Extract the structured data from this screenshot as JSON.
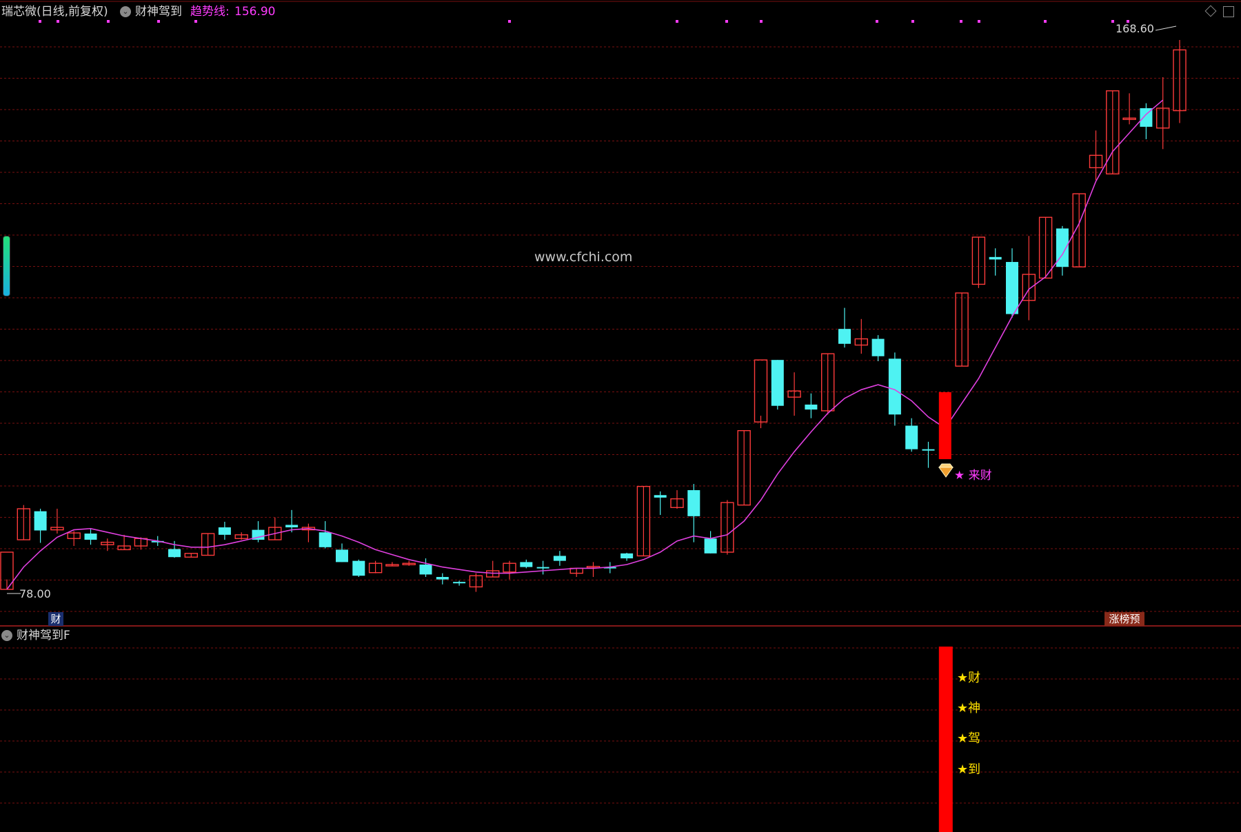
{
  "header": {
    "title": "瑞芯微(日线,前复权)",
    "indicator_name": "财神驾到",
    "trend_label": "趋势线:",
    "trend_value": "156.90"
  },
  "watermark": "www.cfchi.com",
  "price_labels": {
    "high": "168.60",
    "low": "78.00"
  },
  "signal": {
    "label": "★ 来财"
  },
  "badges": {
    "left": "财",
    "right": "涨榜预"
  },
  "sub_panel": {
    "title": "财神驾到F",
    "labels": [
      "★财",
      "★神",
      "★驾",
      "★到"
    ]
  },
  "colors": {
    "up": "#ff3b3b",
    "down": "#4ef2f2",
    "trend": "#e040e0",
    "grid": "#7a1010",
    "signal_bar": "#ff0000",
    "background": "#000000"
  },
  "chart_data": {
    "type": "candlestick",
    "series_name": "趋势线",
    "price_range": [
      78.0,
      168.6
    ],
    "candles": [
      {
        "o": 78,
        "h": 79.6,
        "l": 78,
        "c": 84,
        "up": true
      },
      {
        "o": 86,
        "h": 91.6,
        "l": 86,
        "c": 91,
        "up": true
      },
      {
        "o": 90.6,
        "h": 91,
        "l": 85.5,
        "c": 87.5,
        "up": false
      },
      {
        "o": 88,
        "h": 91,
        "l": 87,
        "c": 87.6,
        "up": true
      },
      {
        "o": 86.2,
        "h": 87.4,
        "l": 85,
        "c": 87.1,
        "up": true
      },
      {
        "o": 87,
        "h": 87.8,
        "l": 85.2,
        "c": 86,
        "up": false
      },
      {
        "o": 85.2,
        "h": 86.2,
        "l": 84.2,
        "c": 85.6,
        "up": true
      },
      {
        "o": 84.4,
        "h": 86.8,
        "l": 84.4,
        "c": 85,
        "up": true
      },
      {
        "o": 85,
        "h": 86.4,
        "l": 84.4,
        "c": 86.2,
        "up": true
      },
      {
        "o": 85.6,
        "h": 86.6,
        "l": 85,
        "c": 85.8,
        "up": false
      },
      {
        "o": 84.5,
        "h": 85.8,
        "l": 83.1,
        "c": 83.2,
        "up": false
      },
      {
        "o": 83.2,
        "h": 83.8,
        "l": 83.2,
        "c": 83.8,
        "up": true
      },
      {
        "o": 83.5,
        "h": 87,
        "l": 83.5,
        "c": 87,
        "up": true
      },
      {
        "o": 88,
        "h": 88.9,
        "l": 86,
        "c": 86.8,
        "up": false
      },
      {
        "o": 86.2,
        "h": 87.2,
        "l": 86,
        "c": 86.8,
        "up": true
      },
      {
        "o": 87.6,
        "h": 89,
        "l": 85.6,
        "c": 86,
        "up": false
      },
      {
        "o": 86,
        "h": 89.6,
        "l": 86,
        "c": 88,
        "up": true
      },
      {
        "o": 88.4,
        "h": 90.8,
        "l": 87.2,
        "c": 88,
        "up": false
      },
      {
        "o": 87.6,
        "h": 88.6,
        "l": 85.6,
        "c": 88,
        "up": true
      },
      {
        "o": 87.2,
        "h": 89,
        "l": 84.6,
        "c": 84.8,
        "up": false
      },
      {
        "o": 84.4,
        "h": 85.4,
        "l": 82.4,
        "c": 82.4,
        "up": false
      },
      {
        "o": 82.6,
        "h": 82.8,
        "l": 80,
        "c": 80.2,
        "up": false
      },
      {
        "o": 80.7,
        "h": 82.6,
        "l": 80.6,
        "c": 82.2,
        "up": true
      },
      {
        "o": 82,
        "h": 82.4,
        "l": 81.8,
        "c": 82,
        "up": true
      },
      {
        "o": 82.2,
        "h": 82.6,
        "l": 81.8,
        "c": 82,
        "up": true
      },
      {
        "o": 82,
        "h": 83,
        "l": 80,
        "c": 80.4,
        "up": false
      },
      {
        "o": 80,
        "h": 80.6,
        "l": 78.8,
        "c": 79.6,
        "up": false
      },
      {
        "o": 79.2,
        "h": 79.4,
        "l": 78.6,
        "c": 79,
        "up": false
      },
      {
        "o": 78.4,
        "h": 80.6,
        "l": 77.6,
        "c": 80.2,
        "up": true
      },
      {
        "o": 80,
        "h": 82.6,
        "l": 80,
        "c": 81,
        "up": true
      },
      {
        "o": 80.8,
        "h": 82.6,
        "l": 79.6,
        "c": 82.2,
        "up": true
      },
      {
        "o": 82.4,
        "h": 82.8,
        "l": 81.4,
        "c": 81.6,
        "up": false
      },
      {
        "o": 81.6,
        "h": 82.6,
        "l": 80.4,
        "c": 81.4,
        "up": false
      },
      {
        "o": 82.6,
        "h": 84.2,
        "l": 81.8,
        "c": 83.4,
        "up": false
      },
      {
        "o": 80.6,
        "h": 81.4,
        "l": 80,
        "c": 81.4,
        "up": true
      },
      {
        "o": 81.6,
        "h": 82.4,
        "l": 80,
        "c": 81.7,
        "up": true
      },
      {
        "o": 81.6,
        "h": 82.4,
        "l": 80.6,
        "c": 81.4,
        "up": false
      },
      {
        "o": 83.8,
        "h": 83.9,
        "l": 82.6,
        "c": 83,
        "up": false
      },
      {
        "o": 83.4,
        "h": 94.6,
        "l": 83.4,
        "c": 94.6,
        "up": true
      },
      {
        "o": 93.2,
        "h": 93.8,
        "l": 90,
        "c": 92.8,
        "up": false
      },
      {
        "o": 91.2,
        "h": 94,
        "l": 91,
        "c": 92.6,
        "up": true
      },
      {
        "o": 94,
        "h": 95,
        "l": 85.6,
        "c": 89.8,
        "up": false
      },
      {
        "o": 86.2,
        "h": 87.4,
        "l": 83.8,
        "c": 83.8,
        "up": false
      },
      {
        "o": 84,
        "h": 92.4,
        "l": 83.6,
        "c": 92,
        "up": true
      },
      {
        "o": 91.6,
        "h": 103.6,
        "l": 91.6,
        "c": 103.6,
        "up": true
      },
      {
        "o": 105,
        "h": 106,
        "l": 104,
        "c": 115,
        "up": true
      },
      {
        "o": 115,
        "h": 115,
        "l": 107,
        "c": 107.6,
        "up": false
      },
      {
        "o": 109,
        "h": 113,
        "l": 106,
        "c": 110,
        "up": true
      },
      {
        "o": 107.8,
        "h": 109.6,
        "l": 105.6,
        "c": 107,
        "up": false
      },
      {
        "o": 106.8,
        "h": 116,
        "l": 106.2,
        "c": 116,
        "up": true
      },
      {
        "o": 120,
        "h": 123.4,
        "l": 117,
        "c": 117.6,
        "up": false
      },
      {
        "o": 117.4,
        "h": 121.6,
        "l": 116,
        "c": 118.4,
        "up": true
      },
      {
        "o": 118.4,
        "h": 119,
        "l": 114.8,
        "c": 115.6,
        "up": false
      },
      {
        "o": 115.2,
        "h": 116.2,
        "l": 104.4,
        "c": 106.2,
        "up": false
      },
      {
        "o": 104.4,
        "h": 105.6,
        "l": 100.2,
        "c": 100.6,
        "up": false
      },
      {
        "o": 100.6,
        "h": 101.8,
        "l": 97.6,
        "c": 100.6,
        "up": false
      },
      {
        "o": 99,
        "h": 109.8,
        "l": 99,
        "c": 109.8,
        "up": true
      },
      {
        "o": 114,
        "h": 125.8,
        "l": 114,
        "c": 125.8,
        "up": true
      },
      {
        "o": 127.2,
        "h": 134.8,
        "l": 126.6,
        "c": 134.8,
        "up": true
      },
      {
        "o": 131.6,
        "h": 133,
        "l": 128.6,
        "c": 131.2,
        "up": false
      },
      {
        "o": 130.8,
        "h": 133,
        "l": 121.8,
        "c": 122.4,
        "up": false
      },
      {
        "o": 124.6,
        "h": 135,
        "l": 121.4,
        "c": 128.8,
        "up": true
      },
      {
        "o": 128.2,
        "h": 138,
        "l": 128.2,
        "c": 138,
        "up": true
      },
      {
        "o": 136.2,
        "h": 136.6,
        "l": 128.6,
        "c": 130,
        "up": false
      },
      {
        "o": 130,
        "h": 141.8,
        "l": 130,
        "c": 141.8,
        "up": true
      },
      {
        "o": 146,
        "h": 152,
        "l": 144,
        "c": 148,
        "up": true
      },
      {
        "o": 145,
        "h": 158.4,
        "l": 145,
        "c": 158.4,
        "up": true
      },
      {
        "o": 154,
        "h": 158,
        "l": 153,
        "c": 154,
        "up": true
      },
      {
        "o": 155.6,
        "h": 156.4,
        "l": 150.6,
        "c": 152.6,
        "up": false
      },
      {
        "o": 155.6,
        "h": 160.6,
        "l": 149,
        "c": 152.4,
        "up": true
      },
      {
        "o": 155.2,
        "h": 166.6,
        "l": 153.2,
        "c": 165,
        "up": true
      }
    ],
    "trend_line": [
      78,
      81.6,
      84.2,
      86.4,
      87.6,
      87.8,
      87.2,
      86.6,
      86.2,
      85.8,
      85.2,
      84.8,
      84.8,
      85.2,
      85.8,
      86.4,
      87,
      87.6,
      87.8,
      87.4,
      86.6,
      85.6,
      84.4,
      83.6,
      82.8,
      82.2,
      81.6,
      81.2,
      80.8,
      80.6,
      80.6,
      80.8,
      81,
      81.2,
      81.4,
      81.4,
      81.6,
      82,
      82.8,
      84,
      85.8,
      86.6,
      86.2,
      86.8,
      89,
      92.4,
      96.6,
      100.2,
      103.4,
      106.4,
      108.8,
      110.2,
      111,
      110.2,
      108.4,
      105.8,
      104,
      108,
      112,
      117,
      122,
      126.4,
      128.4,
      132,
      137,
      143.8,
      148.6,
      151.6,
      154.6,
      156.9
    ],
    "signal_index": 56
  }
}
